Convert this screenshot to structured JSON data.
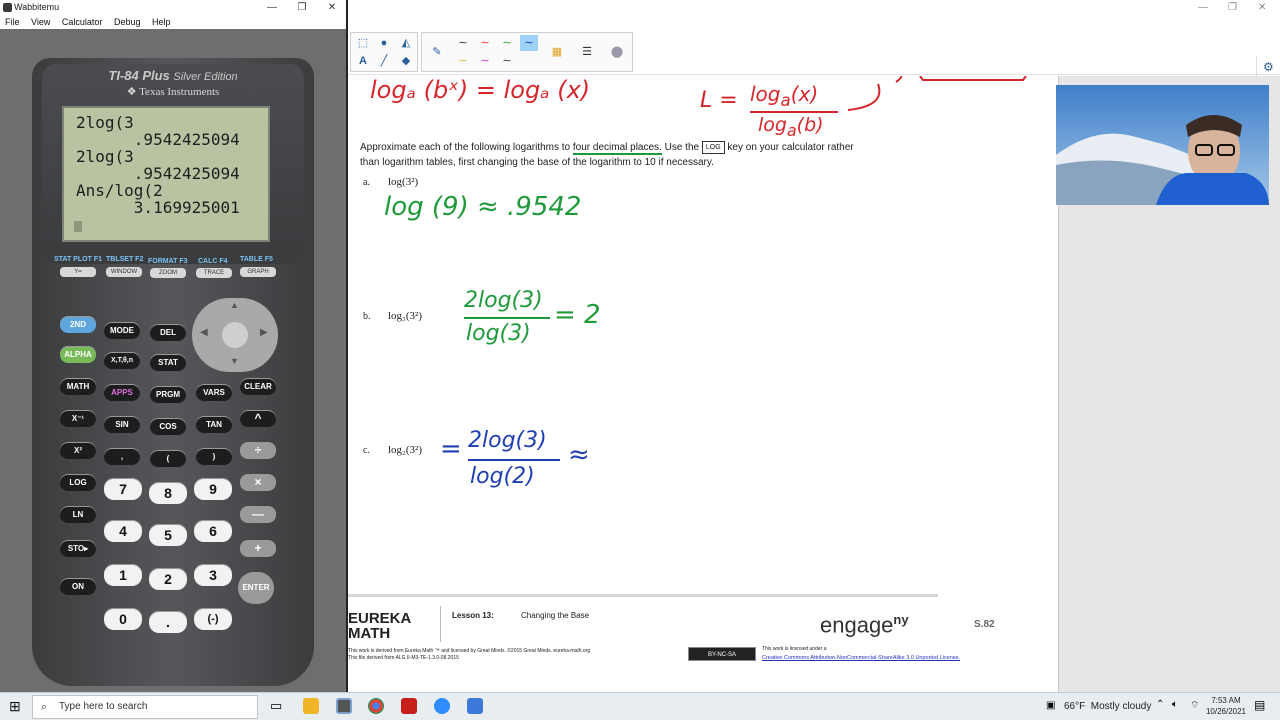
{
  "wabbitemu": {
    "title": "Wabbitemu",
    "menu": [
      "File",
      "View",
      "Calculator",
      "Debug",
      "Help"
    ],
    "brand_model": "TI-84 Plus",
    "brand_edition": "Silver Edition",
    "brand_maker": "Texas Instruments",
    "screen_lines": [
      "2log(3",
      "      .9542425094",
      "2log(3",
      "      .9542425094",
      "Ans/log(2",
      "      3.169925001"
    ],
    "fn_heads": [
      "STAT PLOT F1",
      "TBLSET F2",
      "FORMAT F3",
      "CALC F4",
      "TABLE F5"
    ],
    "fn_keys": [
      "Y=",
      "WINDOW",
      "ZOOM",
      "TRACE",
      "GRAPH"
    ],
    "keys": {
      "second": "2ND",
      "mode": "MODE",
      "del": "DEL",
      "alpha": "ALPHA",
      "xton": "X,T,θ,n",
      "stat": "STAT",
      "math": "MATH",
      "apps": "APPS",
      "prgm": "PRGM",
      "vars": "VARS",
      "clear": "CLEAR",
      "xinv": "X⁻¹",
      "sin": "SIN",
      "cos": "COS",
      "tan": "TAN",
      "pow": "^",
      "xsq": "X²",
      "comma": ",",
      "lparen": "(",
      "rparen": ")",
      "div": "÷",
      "log": "LOG",
      "seven": "7",
      "eight": "8",
      "nine": "9",
      "mul": "×",
      "ln": "LN",
      "four": "4",
      "five": "5",
      "six": "6",
      "minus": "—",
      "sto": "STO▸",
      "one": "1",
      "two": "2",
      "three": "3",
      "plus": "+",
      "on": "ON",
      "zero": "0",
      "dot": ".",
      "neg": "(-)",
      "enter": "ENTER"
    }
  },
  "doc": {
    "top_handwriting_left": "logₐ (bˣ) = logₐ (x)",
    "top_handwriting_right": "L = logₐ(x) / logₐ(b)",
    "instruction_1a": "Approximate each of the following logarithms to ",
    "instruction_1b": "four decimal places.",
    "instruction_1c": " Use the ",
    "instruction_key": "LOG",
    "instruction_1d": " key on your calculator rather",
    "instruction_2": "than logarithm tables, first changing the base of the logarithm to 10 if necessary.",
    "item_a_label": "a.",
    "item_a_expr": "log(3²)",
    "item_a_work": "log (9) ≈ .9542",
    "item_b_label": "b.",
    "item_b_expr": "log₃(3²)",
    "item_b_num": "2log(3)",
    "item_b_den": "log(3)",
    "item_b_result": "= 2",
    "item_c_label": "c.",
    "item_c_expr": "log₂(3²)",
    "item_c_num": "2log(3)",
    "item_c_den": "log(2)",
    "item_c_approx": "≈",
    "footer_brand1": "EUREKA",
    "footer_brand2": "MATH",
    "footer_lesson": "Lesson 13:",
    "footer_topic": "Changing the Base",
    "footer_engage": "engage",
    "footer_ny": "ny",
    "footer_page": "S.82",
    "footer_small1": "This work is derived from Eureka Math ™ and licensed by Great Minds. ©2015 Great Minds. eureka-math.org",
    "footer_small2": "This file derived from ALG II-M3-TE-1.3.0-08.2015",
    "footer_cc": "BY-NC-SA",
    "footer_license1": "This work is licensed under a",
    "footer_license2": "Creative Commons Attribution-NonCommercial-ShareAlike 3.0 Unported License."
  },
  "taskbar": {
    "search_placeholder": "Type here to search",
    "weather": "66°F  Mostly cloudy",
    "time": "7:53 AM",
    "date": "10/26/2021"
  },
  "colors": {
    "handwriting_red": "#d6262b",
    "handwriting_green": "#1f9a3a",
    "handwriting_blue": "#1f3fb5",
    "highlight_green": "#1f9a3a"
  }
}
